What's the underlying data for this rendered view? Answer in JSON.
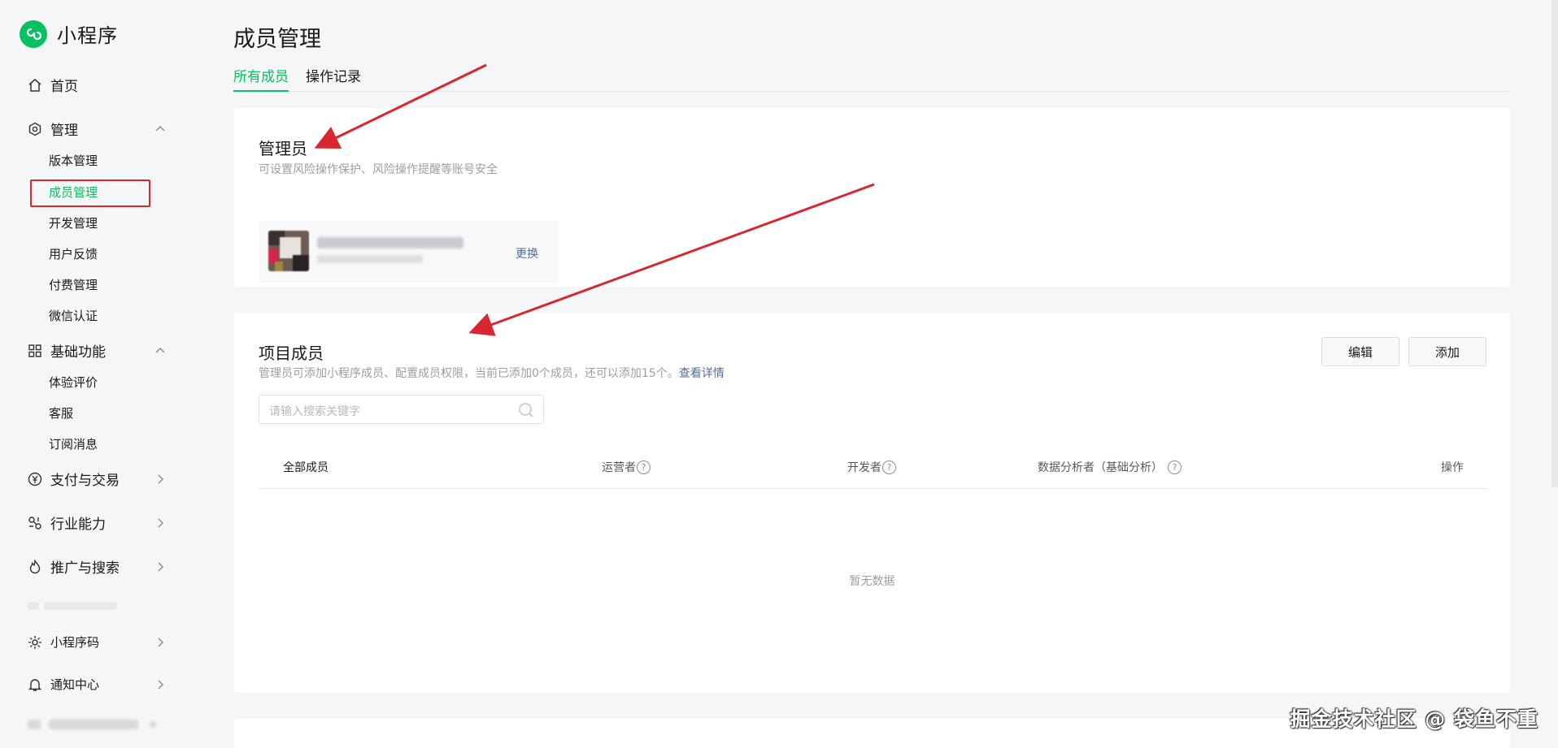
{
  "app": {
    "logo_name": "小程序",
    "logo_icon": "mini-program-icon",
    "accent": "#07c160"
  },
  "sidebar": {
    "home": {
      "label": "首页",
      "icon": "home-icon"
    },
    "manage": {
      "label": "管理",
      "icon": "gear-icon",
      "expanded": true,
      "items": [
        "版本管理",
        "成员管理",
        "开发管理",
        "用户反馈",
        "付费管理",
        "微信认证"
      ],
      "active": "成员管理"
    },
    "basic": {
      "label": "基础功能",
      "icon": "grid-icon",
      "expanded": true,
      "items": [
        "体验评价",
        "客服",
        "订阅消息"
      ]
    },
    "pay": {
      "label": "支付与交易",
      "icon": "yen-icon"
    },
    "industry": {
      "label": "行业能力",
      "icon": "industry-icon"
    },
    "promo": {
      "label": "推广与搜索",
      "icon": "fire-icon"
    },
    "code": {
      "label": "小程序码",
      "icon": "sun-icon"
    },
    "notify": {
      "label": "通知中心",
      "icon": "bell-icon"
    }
  },
  "page": {
    "title": "成员管理",
    "tabs": [
      {
        "label": "所有成员",
        "active": true
      },
      {
        "label": "操作记录",
        "active": false
      }
    ]
  },
  "admin_card": {
    "title": "管理员",
    "desc": "可设置风险操作保护、风险操作提醒等账号安全",
    "swap_label": "更换"
  },
  "members_card": {
    "title": "项目成员",
    "desc": "管理员可添加小程序成员、配置成员权限，当前已添加0个成员，还可以添加15个。",
    "desc_link": "查看详情",
    "edit_label": "编辑",
    "add_label": "添加",
    "search_placeholder": "请输入搜索关键字",
    "columns": [
      "全部成员",
      "运营者",
      "开发者",
      "数据分析者（基础分析）",
      "操作"
    ],
    "empty": "暂无数据"
  },
  "watermark": "掘金技术社区 @ 袋鱼不重"
}
